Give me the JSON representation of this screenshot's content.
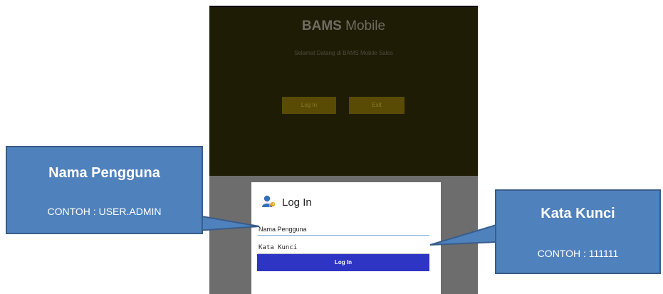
{
  "app": {
    "title_bold": "BAMS",
    "title_rest": " Mobile",
    "subtitle": "Selamat Datang di BAMS Mobile Sales",
    "login_label": "Log In",
    "exit_label": "Exit"
  },
  "dialog": {
    "icon": "key-user-icon",
    "title": "Log In",
    "username_value": "Nama Pengguna",
    "password_value": "Kata Kunci",
    "submit_label": "Log In"
  },
  "callouts": {
    "username": {
      "title": "Nama Pengguna",
      "example": "CONTOH : USER.ADMIN"
    },
    "password": {
      "title": "Kata Kunci",
      "example": "CONTOH : 111111"
    }
  },
  "colors": {
    "callout_fill": "#4f81bd",
    "callout_border": "#385d8a",
    "dialog_button": "#2e34c3",
    "field_underline": "#7fb0e3"
  }
}
